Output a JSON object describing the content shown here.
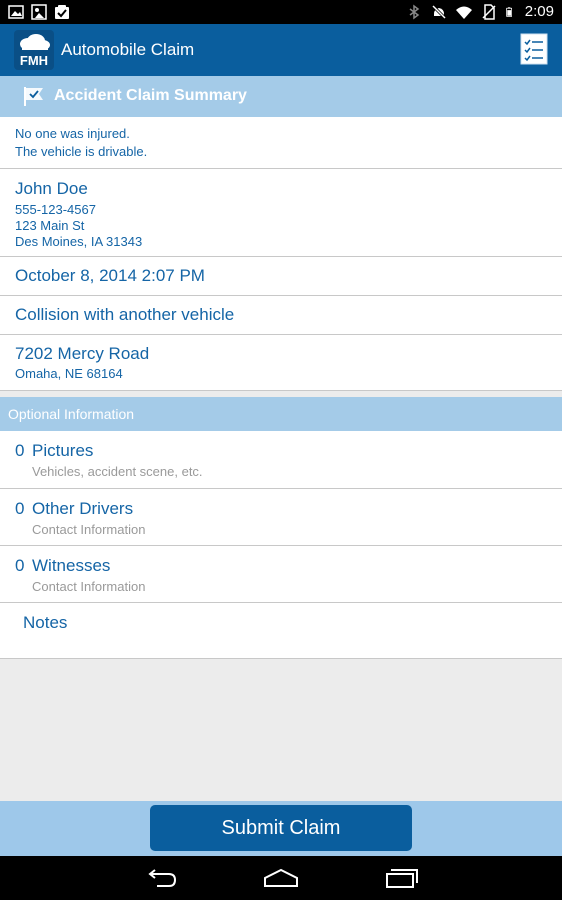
{
  "statusbar": {
    "time": "2:09"
  },
  "appbar": {
    "logo_text": "FMH",
    "title": "Automobile Claim"
  },
  "summary": {
    "header": "Accident Claim Summary",
    "injury_text": "No one was injured.",
    "drivable_text": "The vehicle is drivable.",
    "contact": {
      "name": "John Doe",
      "phone": "555-123-4567",
      "street": "123 Main St",
      "city": "Des Moines, IA 31343"
    },
    "datetime": "October 8, 2014 2:07 PM",
    "accident_type": "Collision with another vehicle",
    "location": {
      "street": "7202 Mercy Road",
      "city": "Omaha, NE 68164"
    }
  },
  "optional": {
    "header": "Optional Information",
    "items": [
      {
        "count": "0",
        "label": "Pictures",
        "sub": "Vehicles, accident scene, etc."
      },
      {
        "count": "0",
        "label": "Other Drivers",
        "sub": "Contact Information"
      },
      {
        "count": "0",
        "label": "Witnesses",
        "sub": "Contact Information"
      }
    ],
    "notes_label": "Notes"
  },
  "submit_label": "Submit Claim",
  "colors": {
    "primary": "#0a5e9e",
    "light": "#a4cbe8",
    "text": "#1565a6"
  }
}
